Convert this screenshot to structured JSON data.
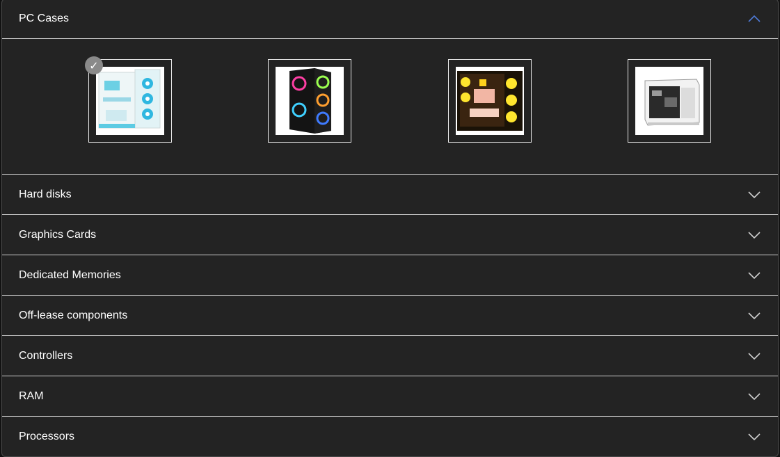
{
  "accordion": {
    "sections": [
      {
        "label": "PC Cases",
        "expanded": true,
        "chevron": "chevron-up-icon"
      },
      {
        "label": "Hard disks",
        "expanded": false,
        "chevron": "chevron-down-icon"
      },
      {
        "label": "Graphics Cards",
        "expanded": false,
        "chevron": "chevron-down-icon"
      },
      {
        "label": "Dedicated Memories",
        "expanded": false,
        "chevron": "chevron-down-icon"
      },
      {
        "label": "Off-lease components",
        "expanded": false,
        "chevron": "chevron-down-icon"
      },
      {
        "label": "Controllers",
        "expanded": false,
        "chevron": "chevron-down-icon"
      },
      {
        "label": "RAM",
        "expanded": false,
        "chevron": "chevron-down-icon"
      },
      {
        "label": "Processors",
        "expanded": false,
        "chevron": "chevron-down-icon"
      }
    ]
  },
  "pc_cases": {
    "items": [
      {
        "name": "white-case-blue-fans",
        "selected": true,
        "check": "✓"
      },
      {
        "name": "black-case-rgb-fans",
        "selected": false
      },
      {
        "name": "black-case-yellow-fans",
        "selected": false
      },
      {
        "name": "white-compact-case",
        "selected": false
      }
    ]
  },
  "colors": {
    "background": "#232323",
    "divider": "#cfcfcf",
    "chevron_up_accent": "#4f7bd9",
    "chevron_down": "#cfcfcf",
    "badge": "#8a8a8a"
  }
}
